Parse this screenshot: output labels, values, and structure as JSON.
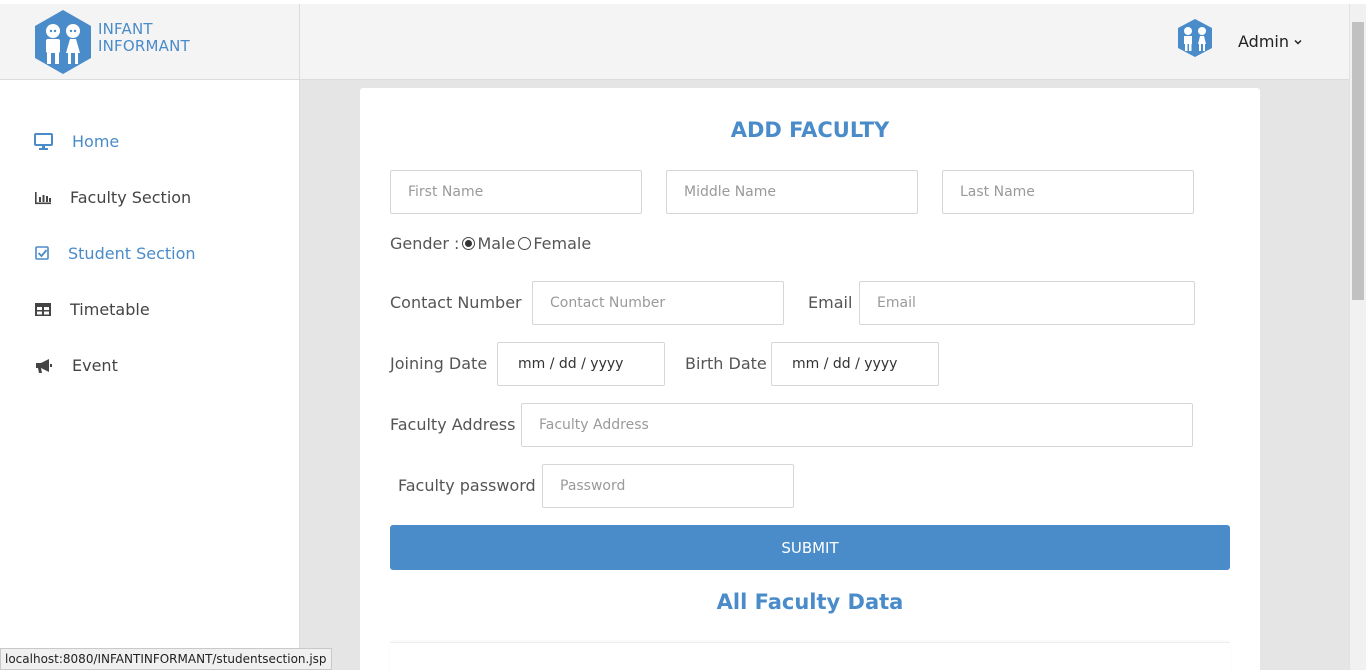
{
  "brand": {
    "line1": "INFANT",
    "line2": "INFORMANT",
    "logo_icon": "children-hexagon-logo",
    "color": "#4a8bc9"
  },
  "header": {
    "user_label": "Admin",
    "avatar_icon": "family-avatar-icon",
    "chevron_icon": "chevron-down-icon"
  },
  "sidebar": {
    "items": [
      {
        "label": "Home",
        "icon": "monitor-icon",
        "active": true
      },
      {
        "label": "Faculty Section",
        "icon": "bar-chart-icon",
        "active": false
      },
      {
        "label": "Student Section",
        "icon": "checkbox-icon",
        "active": true
      },
      {
        "label": "Timetable",
        "icon": "table-icon",
        "active": false
      },
      {
        "label": "Event",
        "icon": "megaphone-icon",
        "active": false
      }
    ]
  },
  "form": {
    "title": "ADD FACULTY",
    "first_name_placeholder": "First Name",
    "middle_name_placeholder": "Middle Name",
    "last_name_placeholder": "Last Name",
    "gender_label": "Gender :",
    "gender_options": [
      {
        "label": "Male",
        "checked": true
      },
      {
        "label": "Female",
        "checked": false
      }
    ],
    "contact_label": "Contact Number",
    "contact_placeholder": "Contact Number",
    "email_label": "Email",
    "email_placeholder": "Email",
    "joining_label": "Joining Date",
    "joining_value": "mm / dd / yyyy",
    "birth_label": "Birth Date",
    "birth_value": "mm / dd / yyyy",
    "address_label": "Faculty Address",
    "address_placeholder": "Faculty Address",
    "password_label": "Faculty password",
    "password_placeholder": "Password",
    "submit_label": "SUBMIT"
  },
  "data_section": {
    "title": "All Faculty Data"
  },
  "statusbar": {
    "url": "localhost:8080/INFANTINFORMANT/studentsection.jsp"
  }
}
